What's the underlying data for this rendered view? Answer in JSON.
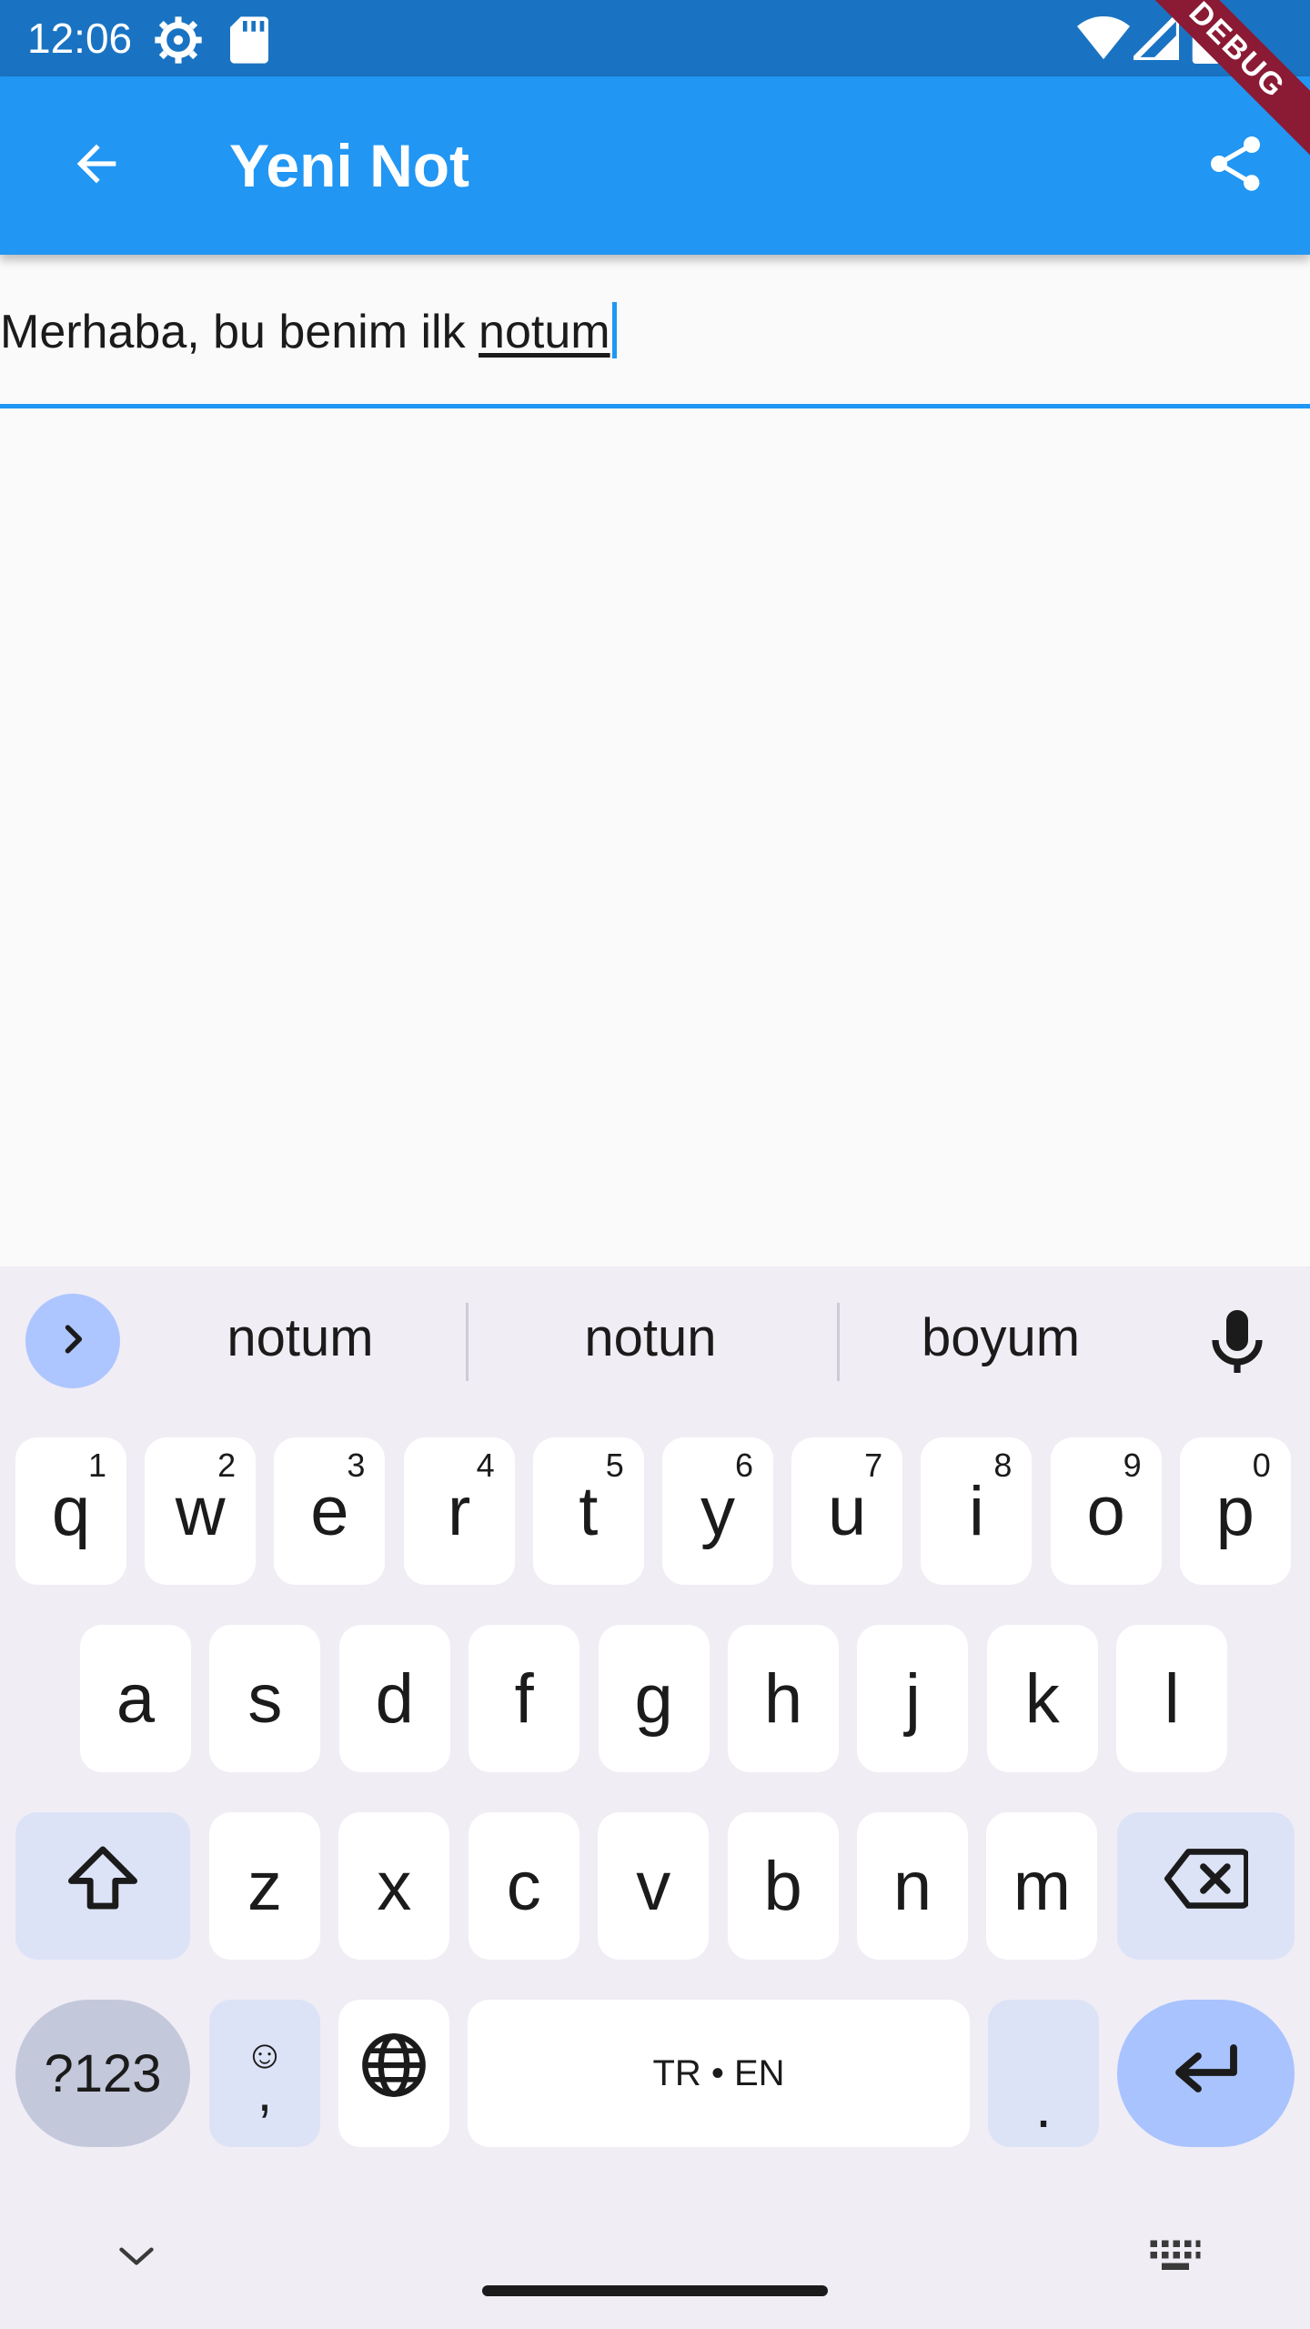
{
  "status_bar": {
    "time": "12:06",
    "icons": [
      "settings-gear-icon",
      "sd-card-icon",
      "wifi-icon",
      "cell-signal-icon",
      "battery-icon"
    ]
  },
  "debug_banner": "DEBUG",
  "app_bar": {
    "title": "Yeni Not",
    "back_icon": "arrow-back-icon",
    "share_icon": "share-icon",
    "color": "#2196f3"
  },
  "note": {
    "text_plain": "Merhaba, bu benim ilk ",
    "text_composing": "notum",
    "accent": "#2196f3"
  },
  "keyboard": {
    "suggestions": [
      "notum",
      "notun",
      "boyum"
    ],
    "row1": [
      {
        "key": "q",
        "hint": "1"
      },
      {
        "key": "w",
        "hint": "2"
      },
      {
        "key": "e",
        "hint": "3"
      },
      {
        "key": "r",
        "hint": "4"
      },
      {
        "key": "t",
        "hint": "5"
      },
      {
        "key": "y",
        "hint": "6"
      },
      {
        "key": "u",
        "hint": "7"
      },
      {
        "key": "i",
        "hint": "8"
      },
      {
        "key": "o",
        "hint": "9"
      },
      {
        "key": "p",
        "hint": "0"
      }
    ],
    "row2": [
      "a",
      "s",
      "d",
      "f",
      "g",
      "h",
      "j",
      "k",
      "l"
    ],
    "row3": [
      "z",
      "x",
      "c",
      "v",
      "b",
      "n",
      "m"
    ],
    "symbols_label": "?123",
    "comma_label": ",",
    "space_label": "TR • EN",
    "period_label": "."
  }
}
